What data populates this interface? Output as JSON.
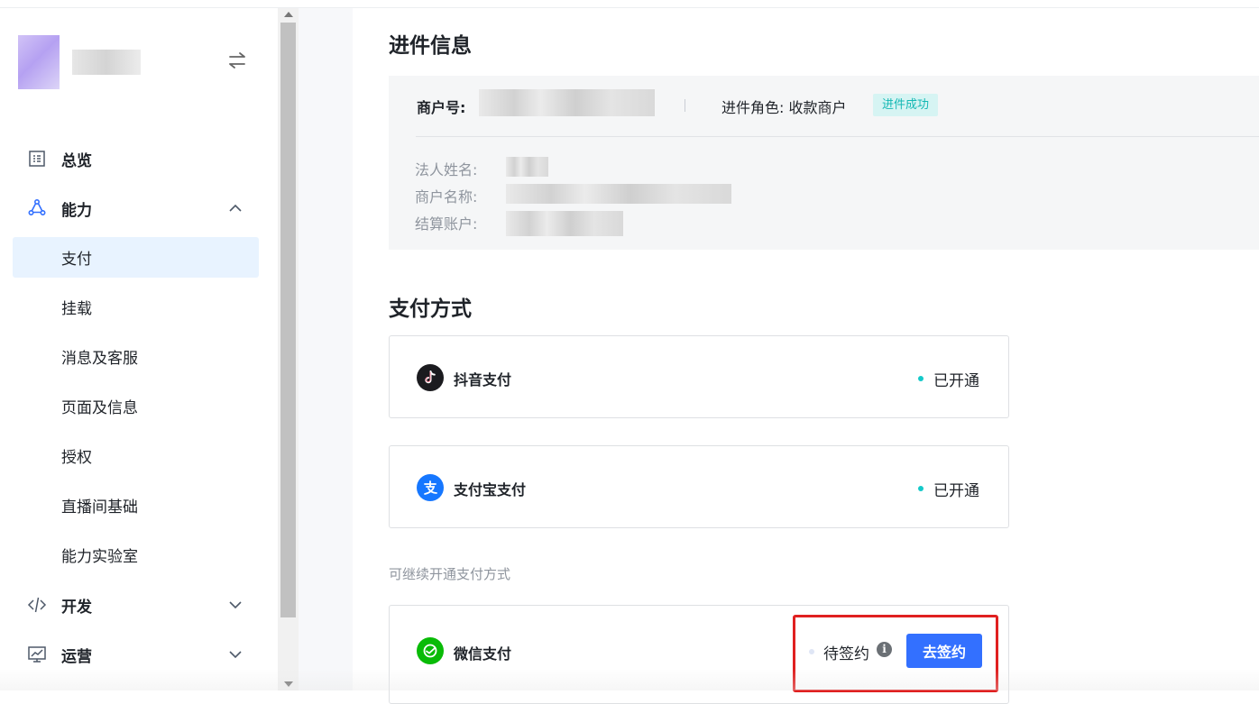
{
  "sidebar": {
    "groups": [
      {
        "label": "总览",
        "icon": "overview-icon"
      },
      {
        "label": "能力",
        "icon": "capability-icon",
        "expanded": true
      },
      {
        "label": "开发",
        "icon": "code-icon",
        "expanded": false
      },
      {
        "label": "运营",
        "icon": "operations-chart-icon",
        "expanded": false
      }
    ],
    "items": [
      {
        "label": "支付",
        "active": true
      },
      {
        "label": "挂载"
      },
      {
        "label": "消息及客服"
      },
      {
        "label": "页面及信息"
      },
      {
        "label": "授权"
      },
      {
        "label": "直播间基础"
      },
      {
        "label": "能力实验室"
      }
    ]
  },
  "main": {
    "onboarding_title": "进件信息",
    "merchant_id_label": "商户号:",
    "role_text": "进件角色: 收款商户",
    "status_badge": "进件成功",
    "fields": {
      "legal_name_label": "法人姓名:",
      "merchant_name_label": "商户名称:",
      "settlement_account_label": "结算账户:"
    },
    "payment_title": "支付方式",
    "methods": [
      {
        "name": "抖音支付",
        "icon": "douyin-icon",
        "status": "已开通",
        "status_color": "#14c9c9"
      },
      {
        "name": "支付宝支付",
        "icon": "alipay-icon",
        "status": "已开通",
        "status_color": "#14c9c9"
      }
    ],
    "available_subtitle": "可继续开通支付方式",
    "available": [
      {
        "name": "微信支付",
        "icon": "wechat-pay-icon",
        "status": "待签约",
        "action": "去签约",
        "status_color": "#dfe6f5"
      }
    ]
  },
  "colors": {
    "accent": "#3370ff",
    "highlight": "#e02020",
    "success": "#14c9c9"
  }
}
